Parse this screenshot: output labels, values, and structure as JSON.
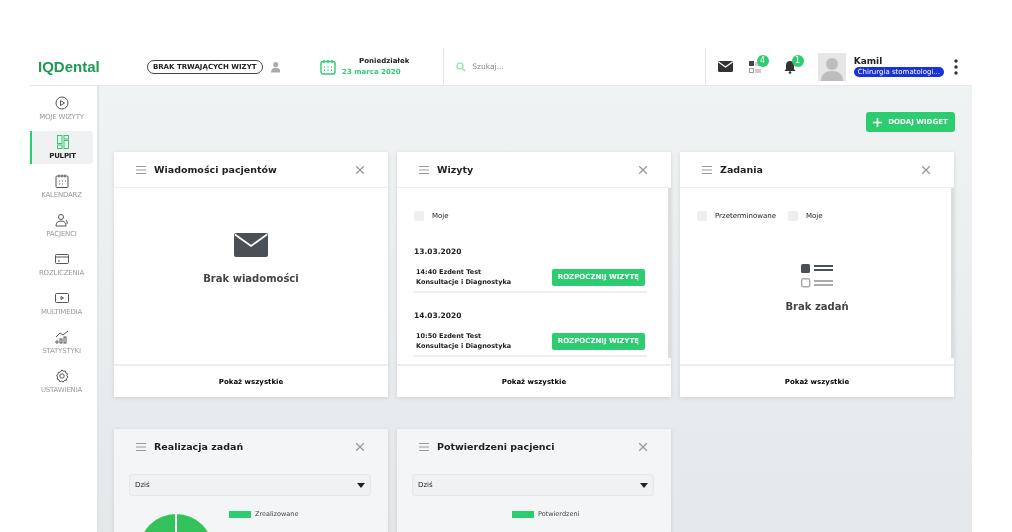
{
  "header": {
    "logo": "IQDental",
    "visit_status": "BRAK TRWAJĄCYCH WIZYT",
    "day": "Poniedziałek",
    "date": "23 marca 2020",
    "search": {
      "placeholder": "Szukaj..."
    },
    "tasks_badge": "4",
    "notifications_badge": "1",
    "user_name": "Kamil",
    "user_role": "Chirurgia stomatologi..."
  },
  "sidebar": {
    "items": [
      {
        "kind": "play",
        "label": "MOJE WIZYTY",
        "selected": false
      },
      {
        "kind": "dashboard",
        "label": "PULPIT",
        "selected": true
      },
      {
        "kind": "calendar",
        "label": "KALENDARZ",
        "selected": false
      },
      {
        "kind": "patients",
        "label": "PACJENCI",
        "selected": false
      },
      {
        "kind": "card",
        "label": "ROZLICZENIA",
        "selected": false
      },
      {
        "kind": "media",
        "label": "MULTIMEDIA",
        "selected": false
      },
      {
        "kind": "stats",
        "label": "STATYSTYKI",
        "selected": false
      },
      {
        "kind": "gear",
        "label": "USTAWIENIA",
        "selected": false
      }
    ]
  },
  "add_widget": "DODAJ WIDGET",
  "widgets": [
    {
      "kind": "messages",
      "title": "Wiadomości pacjentów",
      "empty_text": "Brak wiadomości",
      "footer": "Pokaż wszystkie"
    },
    {
      "kind": "visits",
      "title": "Wizyty",
      "filters": [
        {
          "label": "Moje",
          "checked": false
        }
      ],
      "days": [
        {
          "date": "13.03.2020",
          "visits": [
            {
              "line1": "14:40 Ezdent Test",
              "line2": "Konsultacje i Diagnostyka",
              "action": "ROZPOCZNIJ WIZYTĘ"
            }
          ]
        },
        {
          "date": "14.03.2020",
          "visits": [
            {
              "line1": "10:50 Ezdent Test",
              "line2": "Konsultacje i Diagnostyka",
              "action": "ROZPOCZNIJ WIZYTĘ"
            }
          ]
        }
      ],
      "footer": "Pokaż wszystkie"
    },
    {
      "kind": "tasks",
      "title": "Zadania",
      "filters": [
        {
          "label": "Przeterminowane",
          "checked": false
        },
        {
          "label": "Moje",
          "checked": false
        }
      ],
      "empty_text": "Brak zadań",
      "footer": "Pokaż wszystkie"
    },
    {
      "kind": "pie",
      "title": "Realizacja zadań",
      "select": "Dziś",
      "legend": [
        "Zrealizowane"
      ]
    },
    {
      "kind": "legend",
      "title": "Potwierdzeni pacjenci",
      "select": "Dziś",
      "legend": [
        "Potwierdzeni"
      ]
    }
  ]
}
